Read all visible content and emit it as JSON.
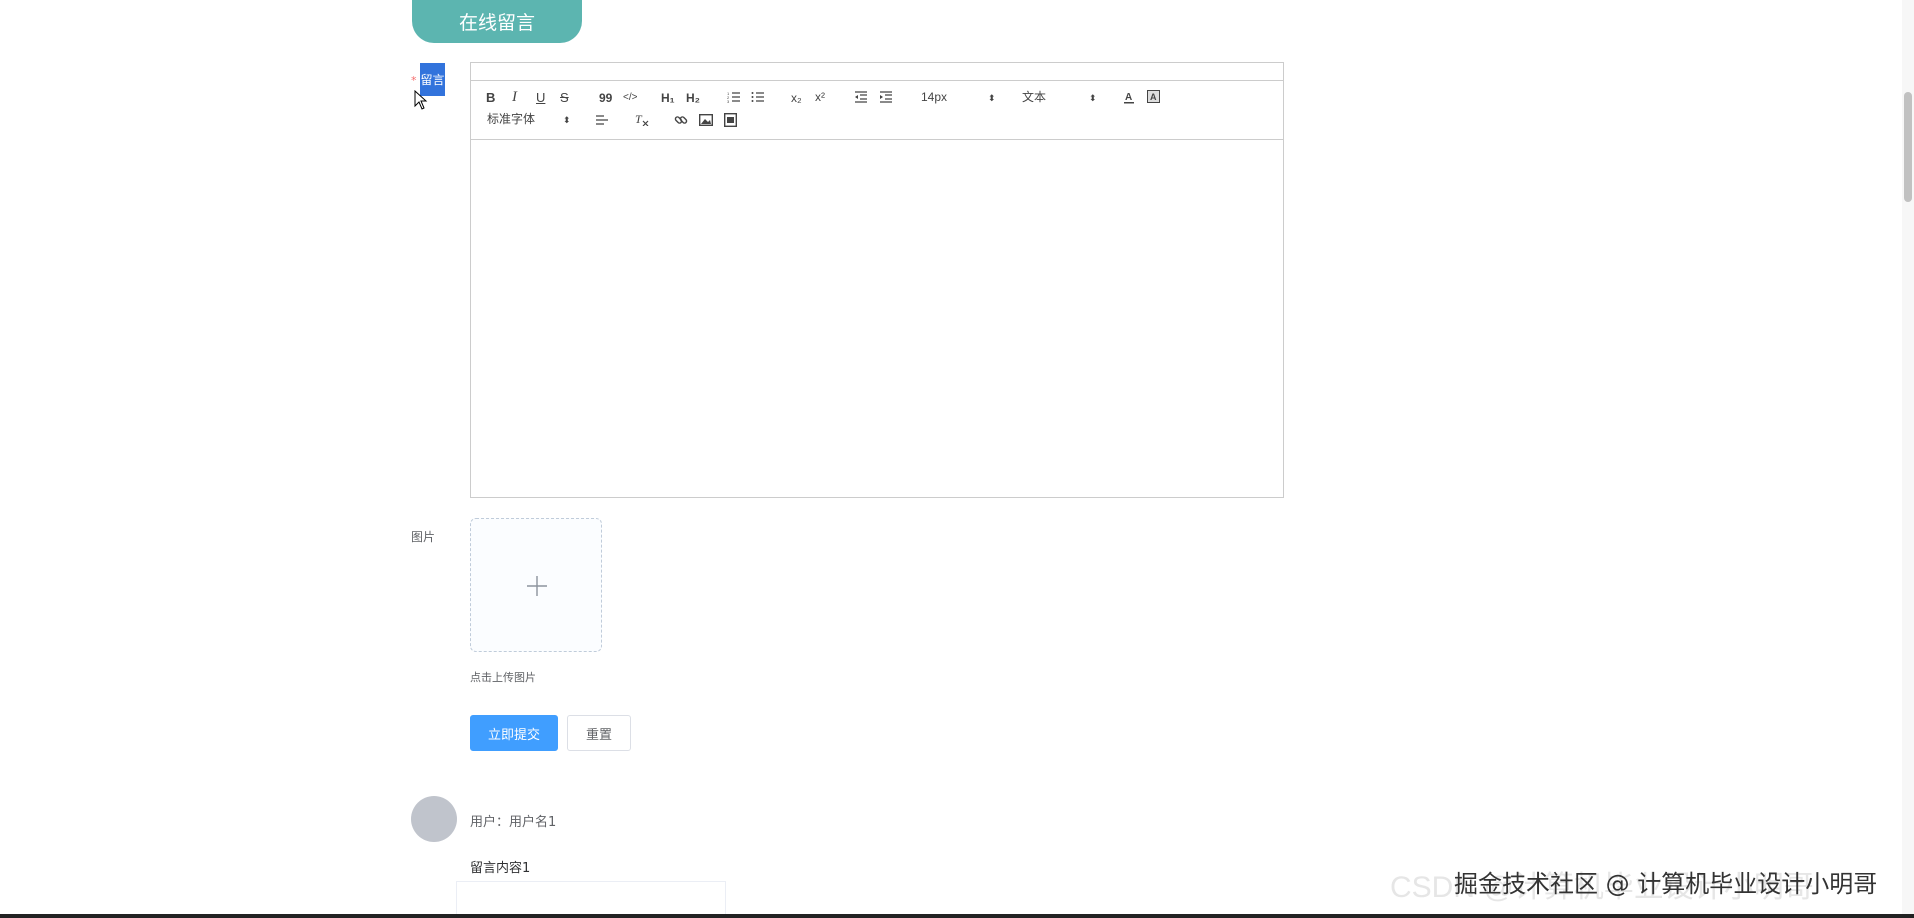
{
  "title": "在线留言",
  "form": {
    "required_mark": "*",
    "message_label": "留言",
    "image_label": "图片",
    "upload_tip": "点击上传图片",
    "submit_label": "立即提交",
    "reset_label": "重置"
  },
  "editor": {
    "toolbar": {
      "bold": "B",
      "italic": "I",
      "underline": "U",
      "strike": "S",
      "blockquote": "99",
      "code": "</>",
      "h1": "H₁",
      "h2": "H₂",
      "subscript": "x₂",
      "superscript": "x²",
      "size_value": "14px",
      "header_value": "文本",
      "font_value": "标准字体",
      "picker_arrow": "⬍"
    },
    "icons": [
      "bold-icon",
      "italic-icon",
      "underline-icon",
      "strike-icon",
      "blockquote-icon",
      "code-block-icon",
      "header1-icon",
      "header2-icon",
      "ordered-list-icon",
      "bullet-list-icon",
      "subscript-icon",
      "superscript-icon",
      "outdent-icon",
      "indent-icon",
      "font-color-icon",
      "background-color-icon",
      "align-icon",
      "clean-format-icon",
      "link-icon",
      "image-icon",
      "video-icon"
    ]
  },
  "comments": [
    {
      "user_line": "用户：用户名1",
      "content": "留言内容1"
    }
  ],
  "watermark": "掘金技术社区 @ 计算机毕业设计小明哥",
  "watermark_faded": "CSDN @计算机毕业设计小明哥",
  "colors": {
    "title_bg": "#5cb5b0",
    "primary": "#409eff",
    "label_highlight": "#3273dc"
  }
}
